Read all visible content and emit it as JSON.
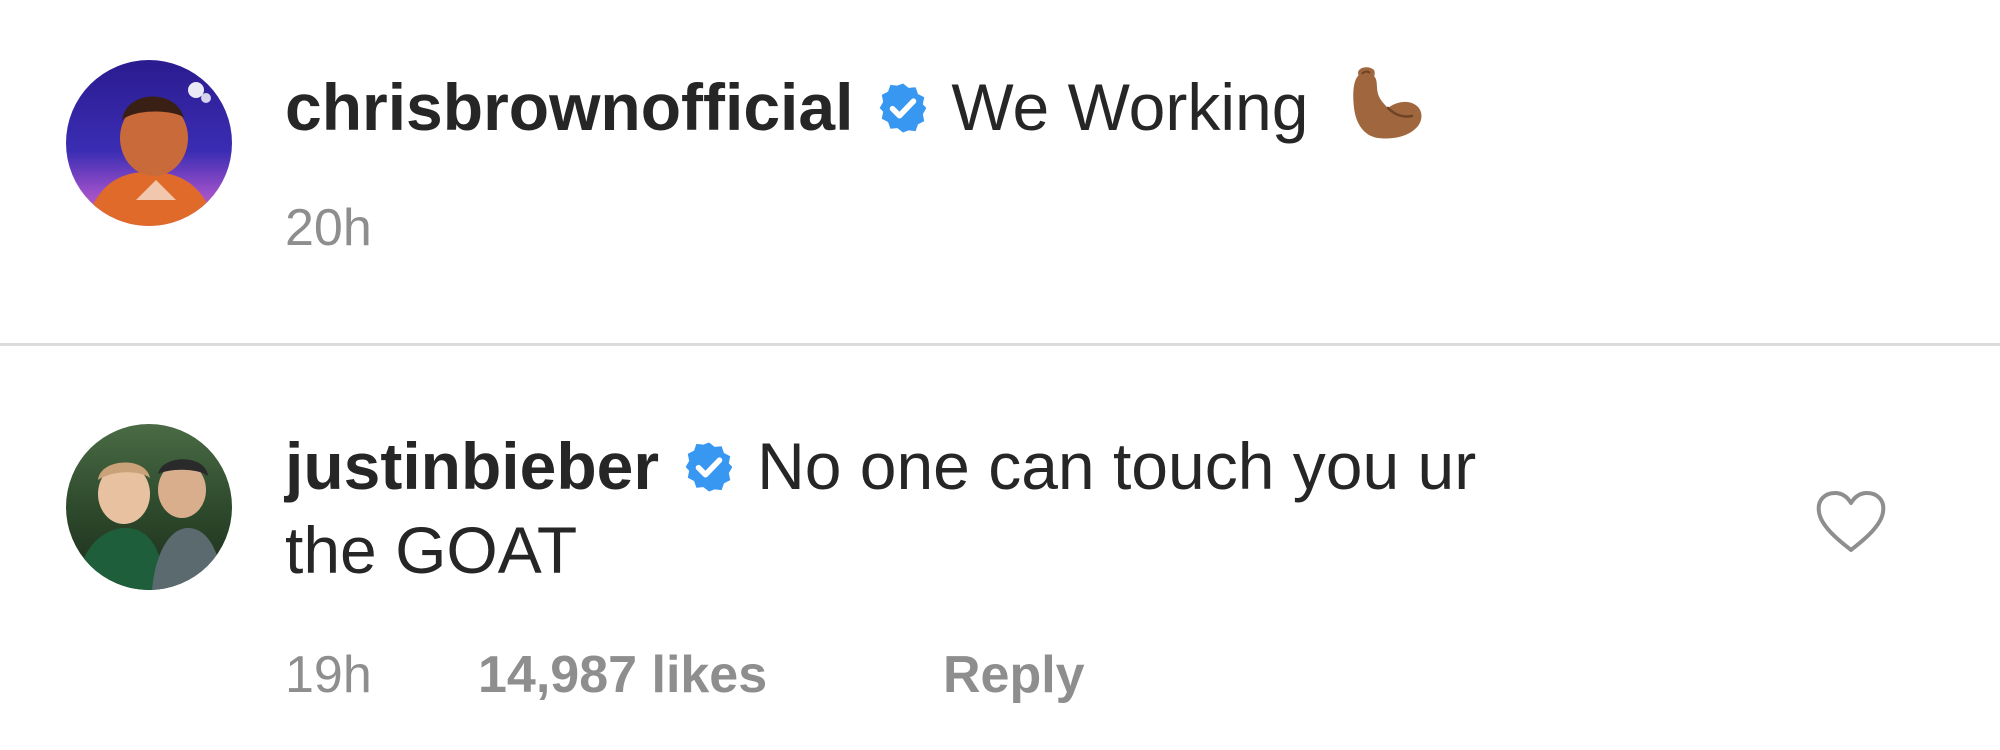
{
  "comments": [
    {
      "username": "chrisbrownofficial",
      "verified": true,
      "text": "We Working",
      "emoji": "flexed-biceps-medium-dark-skin-tone",
      "time": "20h"
    },
    {
      "username": "justinbieber",
      "verified": true,
      "text_line1": "No one can touch you ur",
      "text_line2": "the GOAT",
      "time": "19h",
      "likes": "14,987 likes",
      "reply_label": "Reply",
      "like_icon": "heart-outline-icon"
    }
  ],
  "colors": {
    "verified_badge": "#3897f0",
    "meta_text": "#8e8e8e",
    "divider": "#dbdbdb",
    "primary_text": "#262626"
  }
}
